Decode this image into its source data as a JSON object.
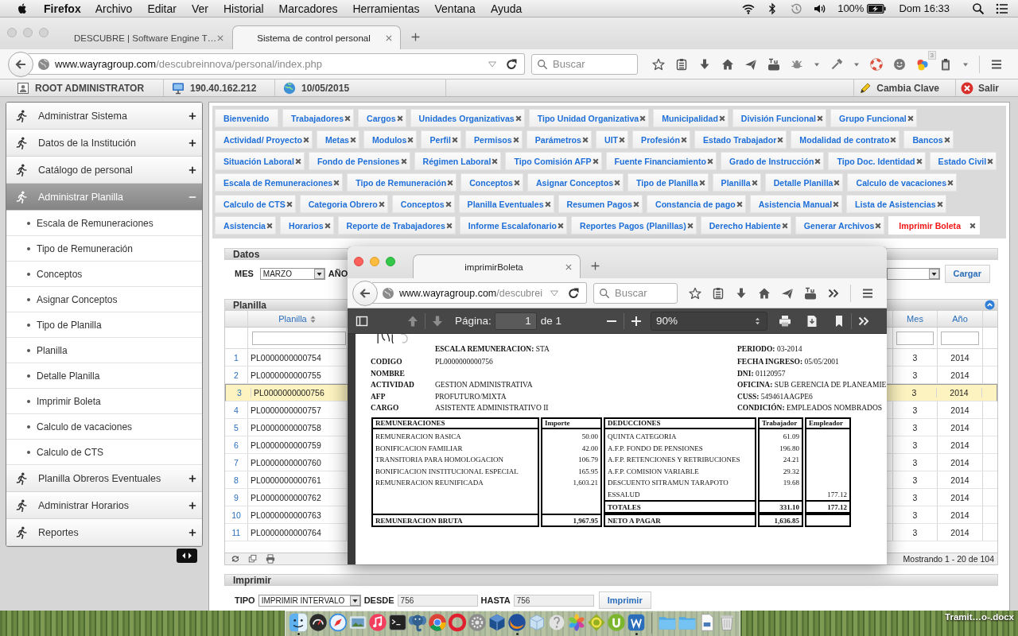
{
  "menubar": {
    "app": "Firefox",
    "menus": [
      "Archivo",
      "Editar",
      "Ver",
      "Historial",
      "Marcadores",
      "Herramientas",
      "Ventana",
      "Ayuda"
    ],
    "battery": "100%",
    "clock": "Dom 16:33"
  },
  "browser": {
    "tabs": [
      {
        "title": "DESCUBRE | Software Engine T…",
        "selected": false
      },
      {
        "title": "Sistema de control personal",
        "selected": true
      }
    ],
    "url": {
      "host": "www.wayragroup.com",
      "path": "/descubreinnova/personal/index.php"
    },
    "search": {
      "placeholder": "Buscar"
    },
    "badge": "3"
  },
  "header": {
    "user": "ROOT ADMINISTRATOR",
    "ip": "190.40.162.212",
    "date": "10/05/2015",
    "change_password": "Cambia Clave",
    "logout": "Salir"
  },
  "sidebar": {
    "sections": [
      {
        "label": "Administrar Sistema",
        "expanded": false
      },
      {
        "label": "Datos de la Institución",
        "expanded": false
      },
      {
        "label": "Catálogo de personal",
        "expanded": false
      },
      {
        "label": "Administrar Planilla",
        "expanded": true,
        "children": [
          "Escala de Remuneraciones",
          "Tipo de Remuneración",
          "Conceptos",
          "Asignar Conceptos",
          "Tipo de Planilla",
          "Planilla",
          "Detalle Planilla",
          "Imprimir Boleta",
          "Calculo de vacaciones",
          "Calculo de CTS"
        ]
      },
      {
        "label": "Planilla Obreros Eventuales",
        "expanded": false
      },
      {
        "label": "Administrar Horarios",
        "expanded": false
      },
      {
        "label": "Reportes",
        "expanded": false
      }
    ]
  },
  "tab_rows": [
    [
      {
        "label": "Bienvenido",
        "closable": false,
        "selected": false
      },
      {
        "label": "Trabajadores",
        "closable": true,
        "selected": false
      },
      {
        "label": "Cargos",
        "closable": true,
        "selected": false
      },
      {
        "label": "Unidades Organizativas",
        "closable": true,
        "selected": false
      },
      {
        "label": "Tipo Unidad Organizativa",
        "closable": true,
        "selected": false
      },
      {
        "label": "Municipalidad",
        "closable": true,
        "selected": false
      },
      {
        "label": "División Funcional",
        "closable": true,
        "selected": false
      },
      {
        "label": "Grupo Funcional",
        "closable": true,
        "selected": false
      }
    ],
    [
      {
        "label": "Actividad/ Proyecto",
        "closable": true,
        "selected": false
      },
      {
        "label": "Metas",
        "closable": true,
        "selected": false
      },
      {
        "label": "Modulos",
        "closable": true,
        "selected": false
      },
      {
        "label": "Perfil",
        "closable": true,
        "selected": false
      },
      {
        "label": "Permisos",
        "closable": true,
        "selected": false
      },
      {
        "label": "Parámetros",
        "closable": true,
        "selected": false
      },
      {
        "label": "UIT",
        "closable": true,
        "selected": false
      },
      {
        "label": "Profesión",
        "closable": true,
        "selected": false
      },
      {
        "label": "Estado Trabajador",
        "closable": true,
        "selected": false
      },
      {
        "label": "Modalidad de contrato",
        "closable": true,
        "selected": false
      },
      {
        "label": "Bancos",
        "closable": true,
        "selected": false
      }
    ],
    [
      {
        "label": "Situación Laboral",
        "closable": true,
        "selected": false
      },
      {
        "label": "Fondo de Pensiones",
        "closable": true,
        "selected": false
      },
      {
        "label": "Régimen Laboral",
        "closable": true,
        "selected": false
      },
      {
        "label": "Tipo Comisión AFP",
        "closable": true,
        "selected": false
      },
      {
        "label": "Fuente Financiamiento",
        "closable": true,
        "selected": false
      },
      {
        "label": "Grado de Instrucción",
        "closable": true,
        "selected": false
      },
      {
        "label": "Tipo Doc. Identidad",
        "closable": true,
        "selected": false
      },
      {
        "label": "Estado Civil",
        "closable": true,
        "selected": false
      }
    ],
    [
      {
        "label": "Escala de Remuneraciones",
        "closable": true,
        "selected": false
      },
      {
        "label": "Tipo de Remuneración",
        "closable": true,
        "selected": false
      },
      {
        "label": "Conceptos",
        "closable": true,
        "selected": false
      },
      {
        "label": "Asignar Conceptos",
        "closable": true,
        "selected": false
      },
      {
        "label": "Tipo de Planilla",
        "closable": true,
        "selected": false
      },
      {
        "label": "Planilla",
        "closable": true,
        "selected": false
      },
      {
        "label": "Detalle Planilla",
        "closable": true,
        "selected": false
      },
      {
        "label": "Calculo de vacaciones",
        "closable": true,
        "selected": false
      }
    ],
    [
      {
        "label": "Calculo de CTS",
        "closable": true,
        "selected": false
      },
      {
        "label": "Categoria Obrero",
        "closable": true,
        "selected": false
      },
      {
        "label": "Conceptos",
        "closable": true,
        "selected": false
      },
      {
        "label": "Planilla Eventuales",
        "closable": true,
        "selected": false
      },
      {
        "label": "Resumen Pagos",
        "closable": true,
        "selected": false
      },
      {
        "label": "Constancia de pago",
        "closable": true,
        "selected": false
      },
      {
        "label": "Asistencia Manual",
        "closable": true,
        "selected": false
      },
      {
        "label": "Lista de Asistencias",
        "closable": true,
        "selected": false
      }
    ],
    [
      {
        "label": "Asistencia",
        "closable": true,
        "selected": false
      },
      {
        "label": "Horarios",
        "closable": true,
        "selected": false
      },
      {
        "label": "Reporte de Trabajadores",
        "closable": true,
        "selected": false
      },
      {
        "label": "Informe Escalafonario",
        "closable": true,
        "selected": false
      },
      {
        "label": "Reportes Pagos (Planillas)",
        "closable": true,
        "selected": false
      },
      {
        "label": "Derecho Habiente",
        "closable": true,
        "selected": false
      },
      {
        "label": "Generar Archivos",
        "closable": true,
        "selected": false
      },
      {
        "label": "Imprimir Boleta",
        "closable": true,
        "selected": true
      }
    ]
  ],
  "datos": {
    "title": "Datos",
    "month_label": "MES",
    "month_value": "MARZO",
    "year_label": "AÑO",
    "load_button": "Cargar"
  },
  "grid": {
    "title": "Planilla",
    "columns": {
      "planilla": "Planilla",
      "month": "Mes",
      "year": "Año"
    },
    "rows": [
      {
        "number": "1",
        "planilla": "PL0000000000754",
        "month": "3",
        "year": "2014",
        "selected": false
      },
      {
        "number": "2",
        "planilla": "PL0000000000755",
        "month": "3",
        "year": "2014",
        "selected": false
      },
      {
        "number": "3",
        "planilla": "PL0000000000756",
        "month": "3",
        "year": "2014",
        "selected": true
      },
      {
        "number": "4",
        "planilla": "PL0000000000757",
        "month": "3",
        "year": "2014",
        "selected": false
      },
      {
        "number": "5",
        "planilla": "PL0000000000758",
        "month": "3",
        "year": "2014",
        "selected": false
      },
      {
        "number": "6",
        "planilla": "PL0000000000759",
        "month": "3",
        "year": "2014",
        "selected": false
      },
      {
        "number": "7",
        "planilla": "PL0000000000760",
        "month": "3",
        "year": "2014",
        "selected": false
      },
      {
        "number": "8",
        "planilla": "PL0000000000761",
        "month": "3",
        "year": "2014",
        "selected": false
      },
      {
        "number": "9",
        "planilla": "PL0000000000762",
        "month": "3",
        "year": "2014",
        "selected": false
      },
      {
        "number": "10",
        "planilla": "PL0000000000763",
        "month": "3",
        "year": "2014",
        "selected": false
      },
      {
        "number": "11",
        "planilla": "PL0000000000764",
        "month": "3",
        "year": "2014",
        "selected": false
      }
    ],
    "footer": "Mostrando 1 - 20 de 104"
  },
  "imprimir": {
    "title": "Imprimir",
    "type_label": "TIPO",
    "type_value": "IMPRIMIR INTERVALO",
    "from_label": "DESDE",
    "from_value": "756",
    "to_label": "HASTA",
    "to_value": "756",
    "button": "Imprimir"
  },
  "popup": {
    "tab_title": "imprimirBoleta",
    "url": {
      "host": "www.wayragroup.com",
      "path": "/descubrei"
    },
    "search": {
      "placeholder": "Buscar"
    },
    "pdf": {
      "page_label": "Página:",
      "page": "1",
      "page_total": "de 1",
      "zoom": "90%"
    },
    "document": {
      "heading": {
        "label": "ESCALA REMUNERACION:",
        "value": "STA"
      },
      "period": {
        "label": "PERIODO:",
        "value": "03-2014"
      },
      "rows": [
        {
          "label": "CODIGO",
          "value": "PL0000000000756",
          "right_label": "FECHA INGRESO:",
          "right_value": "05/05/2001"
        },
        {
          "label": "NOMBRE",
          "right_label": "DNI:",
          "right_value": "01120957"
        },
        {
          "label": "ACTIVIDAD",
          "value": "GESTION ADMINISTRATIVA",
          "right_label": "OFICINA:",
          "right_value": "SUB GERENCIA DE PLANEAMIE"
        },
        {
          "label": "AFP",
          "value": "PROFUTURO/MIXTA",
          "right_label": "CUSS:",
          "right_value": "549461AAGPE6"
        },
        {
          "label": "CARGO",
          "value": "ASISTENTE ADMINISTRATIVO II",
          "right_label": "CONDICIÓN:",
          "right_value": "EMPLEADOS NOMBRADOS"
        }
      ],
      "table": {
        "headers": [
          "REMUNERACIONES",
          "Importe",
          "DEDUCCIONES",
          "Trabajador",
          "Empleador"
        ],
        "lines": [
          {
            "concept": "REMUNERACION BASICA",
            "amount": "50.00",
            "deduction": "QUINTA CATEGORIA",
            "worker": "61.09"
          },
          {
            "concept": "BONIFICACION FAMILIAR",
            "amount": "42.00",
            "deduction": "A.F.P. FONDO DE PENSIONES",
            "worker": "196.80"
          },
          {
            "concept": "TRANSITORIA PARA HOMOLOGACION",
            "amount": "106.79",
            "deduction": "A.F.P. RETENCIONES Y RETRIBUCIONES",
            "worker": "24.21"
          },
          {
            "concept": "BONIFICACION INSTITUCIONAL ESPECIAL",
            "amount": "165.95",
            "deduction": "A.F.P. COMISION VARIABLE",
            "worker": "29.32"
          },
          {
            "concept": "REMUNERACION REUNIFICADA",
            "amount": "1,603.21",
            "deduction": "DESCUENTO SITRAMUN TARAPOTO",
            "worker": "19.68"
          },
          {
            "deduction": "ESSALUD",
            "employer": "177.12"
          }
        ],
        "totals": {
          "label": "TOTALES",
          "worker": "331.10",
          "employer": "177.12"
        },
        "gross": {
          "label": "REMUNERACION BRUTA",
          "amount": "1,967.95"
        },
        "net": {
          "label": "NETO A PAGAR",
          "worker": "1,636.85"
        }
      }
    }
  },
  "desktop": {
    "file_label": "Tramit…o-.docx"
  }
}
